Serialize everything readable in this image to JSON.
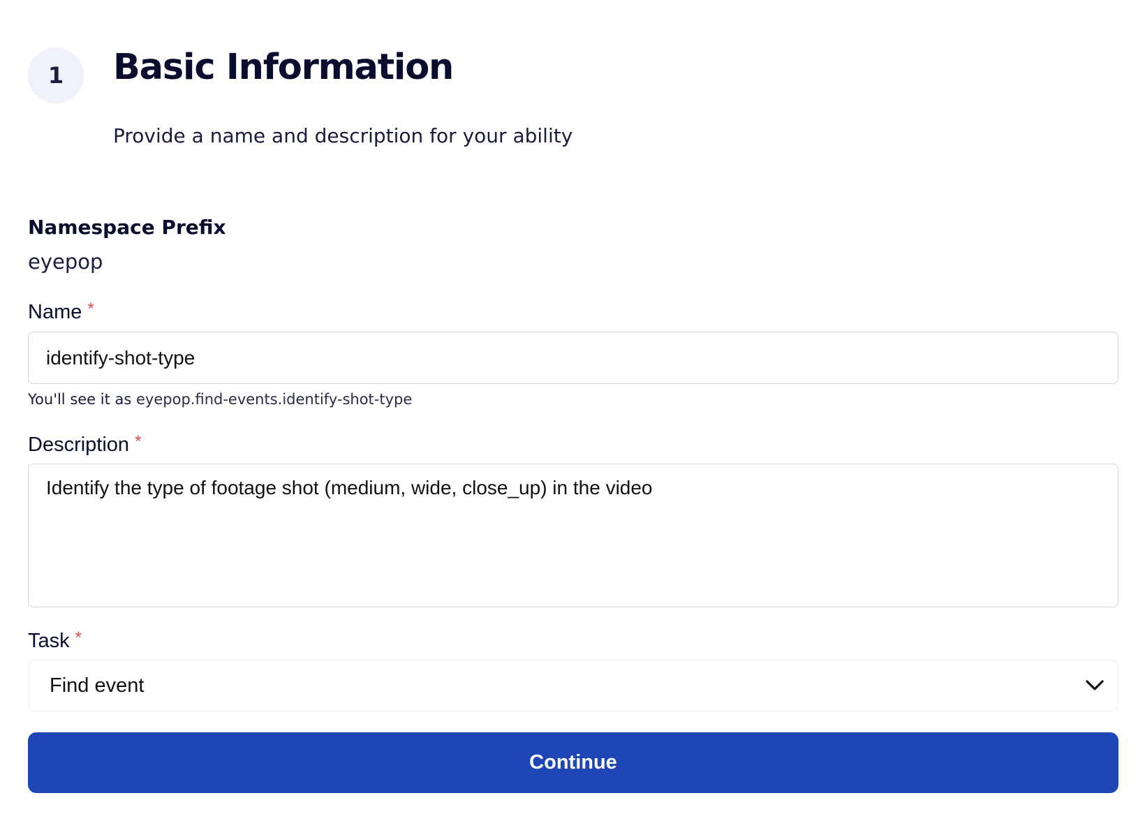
{
  "header": {
    "step_number": "1",
    "title": "Basic Information",
    "subtitle": "Provide a name and description for your ability"
  },
  "namespace": {
    "label": "Namespace Prefix",
    "value": "eyepop"
  },
  "form": {
    "required_marker": "*",
    "name": {
      "label": "Name",
      "value": "identify-shot-type",
      "hint_prefix": "You'll see it as",
      "hint_value": "eyepop.find-events.identify-shot-type"
    },
    "description": {
      "label": "Description",
      "value": "Identify the type of footage shot (medium, wide, close_up) in the video"
    },
    "task": {
      "label": "Task",
      "selected": "Find event",
      "icon": "chevron-down-icon"
    },
    "continue_label": "Continue"
  },
  "colors": {
    "primary": "#1e47b5",
    "required": "#e5484d",
    "text_dark": "#0b0d2e",
    "step_circle_bg": "#eff1fb"
  }
}
